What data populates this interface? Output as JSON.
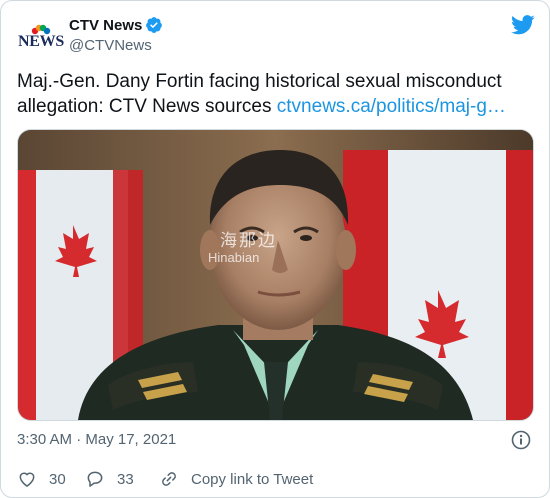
{
  "author": {
    "display_name": "CTV News",
    "handle": "@CTVNews",
    "avatar_text": "NEWS",
    "verified_icon": "verified-badge-icon"
  },
  "tweet": {
    "text": "Maj.-Gen. Dany Fortin facing historical sexual misconduct allegation: CTV News sources ",
    "link_text": "ctvnews.ca/politics/maj-g…",
    "timestamp": "3:30 AM · May 17, 2021"
  },
  "media": {
    "watermark_cn": "海那边",
    "watermark_en": "Hinabian"
  },
  "actions": {
    "likes": "30",
    "replies": "33",
    "copy_link_label": "Copy link to Tweet"
  },
  "colors": {
    "link": "#1b95e0",
    "twitter_blue": "#1d9bf0",
    "like_red": "#e0245e",
    "muted": "#536471"
  }
}
